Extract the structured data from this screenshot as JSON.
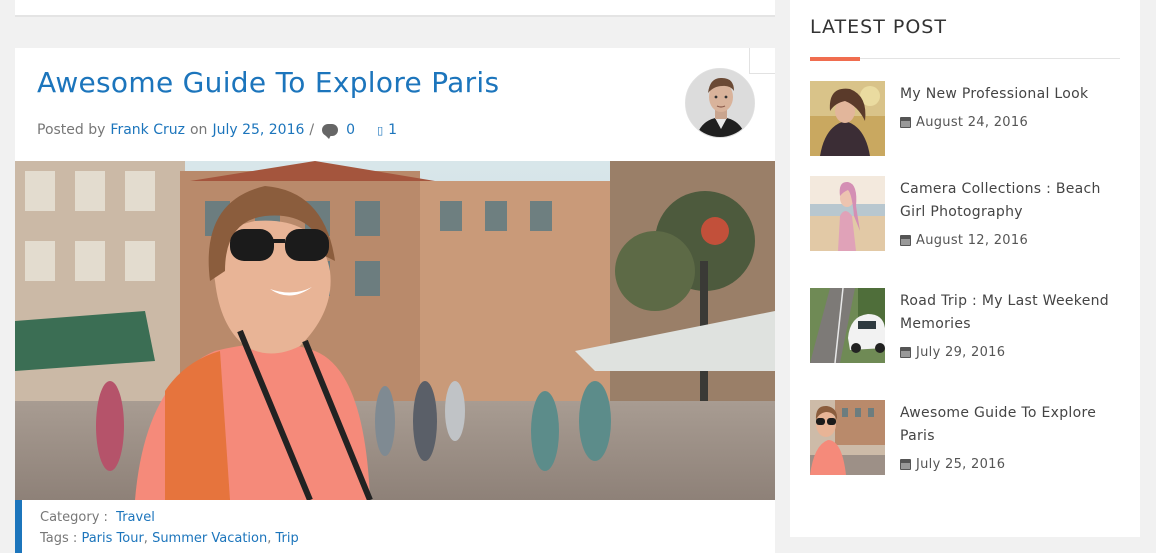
{
  "post": {
    "title": "Awesome Guide To Explore Paris",
    "meta": {
      "posted_by_label": "Posted by",
      "author": "Frank Cruz",
      "on_label": "on",
      "date": "July 25, 2016",
      "separator": "/",
      "comments_count": "0",
      "likes_count": "1"
    },
    "footer": {
      "category_label": "Category :",
      "category": "Travel",
      "tags_label": "Tags :",
      "tags": [
        "Paris Tour",
        "Summer Vacation",
        "Trip"
      ]
    }
  },
  "sidebar": {
    "title": "LATEST POST",
    "items": [
      {
        "title": "My New Professional Look",
        "date": "August 24, 2016"
      },
      {
        "title": "Camera Collections : Beach Girl Photography",
        "date": "August 12, 2016"
      },
      {
        "title": "Road Trip : My Last Weekend Memories",
        "date": "July 29, 2016"
      },
      {
        "title": "Awesome Guide To Explore Paris",
        "date": "July 25, 2016"
      }
    ]
  },
  "colors": {
    "accent_blue": "#1c75bc",
    "accent_orange": "#f06d4f",
    "background": "#f1f1f1"
  },
  "icons": [
    "comment-icon",
    "like-icon",
    "calendar-icon"
  ]
}
